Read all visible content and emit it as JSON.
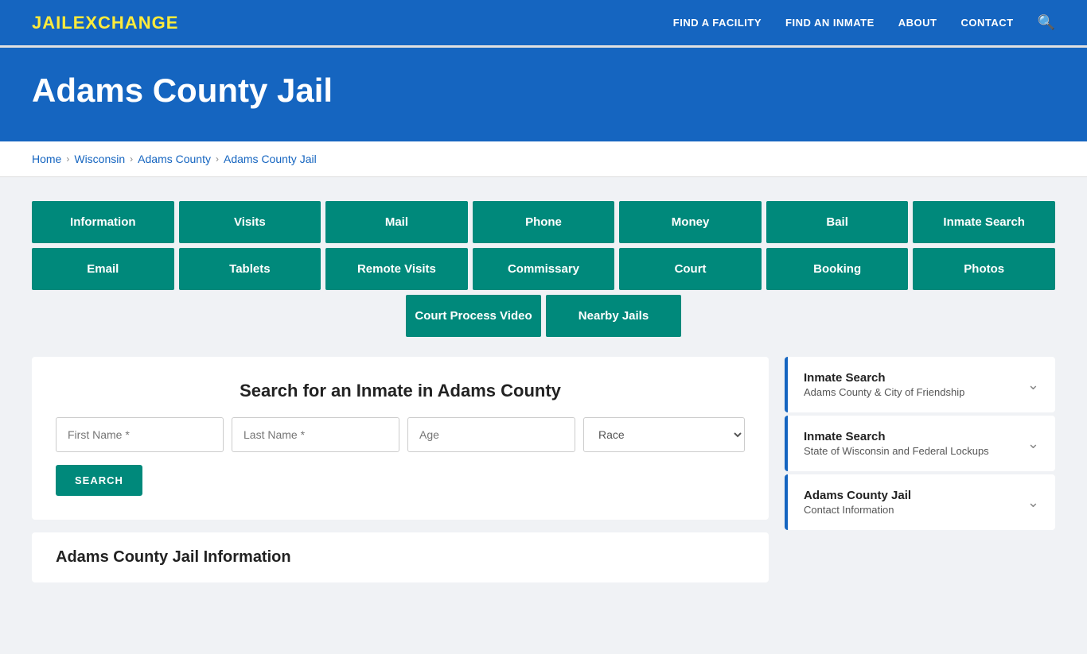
{
  "header": {
    "logo_jail": "JAIL",
    "logo_exchange": "EXCHANGE",
    "nav": [
      {
        "label": "FIND A FACILITY",
        "href": "#"
      },
      {
        "label": "FIND AN INMATE",
        "href": "#"
      },
      {
        "label": "ABOUT",
        "href": "#"
      },
      {
        "label": "CONTACT",
        "href": "#"
      }
    ]
  },
  "hero": {
    "title": "Adams County Jail"
  },
  "breadcrumb": {
    "items": [
      {
        "label": "Home",
        "href": "#"
      },
      {
        "label": "Wisconsin",
        "href": "#"
      },
      {
        "label": "Adams County",
        "href": "#"
      },
      {
        "label": "Adams County Jail",
        "href": "#"
      }
    ]
  },
  "button_grid_row1": [
    "Information",
    "Visits",
    "Mail",
    "Phone",
    "Money",
    "Bail",
    "Inmate Search"
  ],
  "button_grid_row2": [
    "Email",
    "Tablets",
    "Remote Visits",
    "Commissary",
    "Court",
    "Booking",
    "Photos"
  ],
  "button_grid_row3": [
    "Court Process Video",
    "Nearby Jails"
  ],
  "inmate_search": {
    "title": "Search for an Inmate in Adams County",
    "first_name_placeholder": "First Name *",
    "last_name_placeholder": "Last Name *",
    "age_placeholder": "Age",
    "race_placeholder": "Race",
    "search_button": "SEARCH"
  },
  "bottom_section": {
    "title": "Adams County Jail Information"
  },
  "sidebar": {
    "cards": [
      {
        "label": "Inmate Search",
        "sublabel": "Adams County & City of Friendship"
      },
      {
        "label": "Inmate Search",
        "sublabel": "State of Wisconsin and Federal Lockups"
      },
      {
        "label": "Adams County Jail",
        "sublabel": "Contact Information"
      }
    ]
  }
}
